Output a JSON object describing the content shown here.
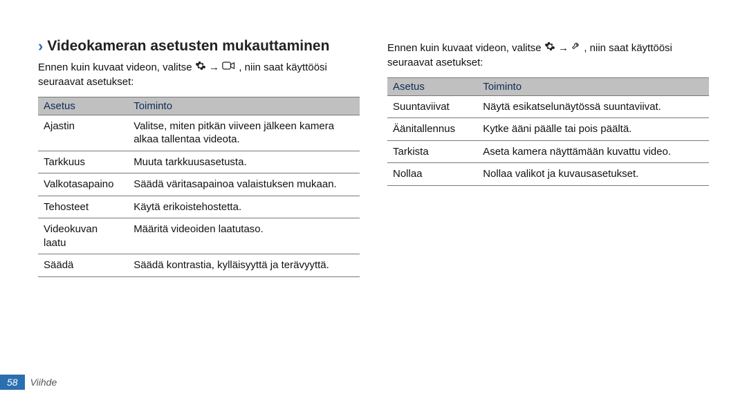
{
  "heading": "Videokameran asetusten mukauttaminen",
  "intro_left_a": "Ennen kuin kuvaat videon, valitse ",
  "intro_left_b": " → ",
  "intro_left_c": ", niin saat käyttöösi seuraavat asetukset:",
  "intro_right_a": "Ennen kuin kuvaat videon, valitse ",
  "intro_right_b": " → ",
  "intro_right_c": ", niin saat käyttöösi seuraavat asetukset:",
  "headers": {
    "asetus": "Asetus",
    "toiminto": "Toiminto"
  },
  "table_left": [
    {
      "asetus": "Ajastin",
      "toiminto": "Valitse, miten pitkän viiveen jälkeen kamera alkaa tallentaa videota."
    },
    {
      "asetus": "Tarkkuus",
      "toiminto": "Muuta tarkkuusasetusta."
    },
    {
      "asetus": "Valkotasapaino",
      "toiminto": "Säädä väritasapainoa valaistuksen mukaan."
    },
    {
      "asetus": "Tehosteet",
      "toiminto": "Käytä erikoistehostetta."
    },
    {
      "asetus": "Videokuvan laatu",
      "toiminto": "Määritä videoiden laatutaso."
    },
    {
      "asetus": "Säädä",
      "toiminto": "Säädä kontrastia, kylläisyyttä ja terävyyttä."
    }
  ],
  "table_right": [
    {
      "asetus": "Suuntaviivat",
      "toiminto": "Näytä esikatselunäytössä suuntaviivat."
    },
    {
      "asetus": "Äänitallennus",
      "toiminto": "Kytke ääni päälle tai pois päältä."
    },
    {
      "asetus": "Tarkista",
      "toiminto": "Aseta kamera näyttämään kuvattu video."
    },
    {
      "asetus": "Nollaa",
      "toiminto": "Nollaa valikot ja kuvausasetukset."
    }
  ],
  "footer": {
    "page": "58",
    "section": "Viihde"
  }
}
